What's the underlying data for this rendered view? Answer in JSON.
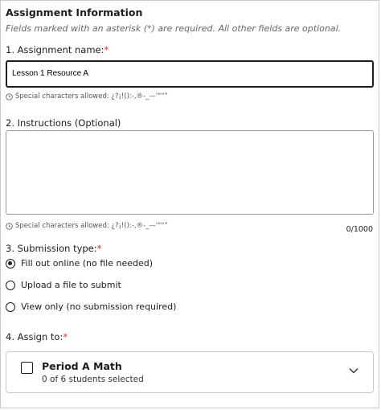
{
  "section_title": "Assignment Information",
  "required_note": "Fields marked with an asterisk (*) are required. All other fields are optional.",
  "name_field": {
    "label": "1. Assignment name:",
    "required_mark": "*",
    "value": "Lesson 1 Resource A",
    "hint": "Special characters allowed: ¿?¡!():-,®-_—'\"“”"
  },
  "instructions_field": {
    "label": "2. Instructions (Optional)",
    "value": "",
    "hint": "Special characters allowed: ¿?¡!():-,®-_—'\"“”",
    "counter": "0/1000"
  },
  "submission": {
    "label": "3. Submission type:",
    "required_mark": "*",
    "options": [
      {
        "label": "Fill out online (no file needed)",
        "selected": true
      },
      {
        "label": "Upload a file to submit",
        "selected": false
      },
      {
        "label": "View only (no submission required)",
        "selected": false
      }
    ]
  },
  "assign": {
    "label": "4. Assign to:",
    "required_mark": "*",
    "class_name": "Period A Math",
    "selection_status": "0 of 6 students selected",
    "checked": false
  }
}
